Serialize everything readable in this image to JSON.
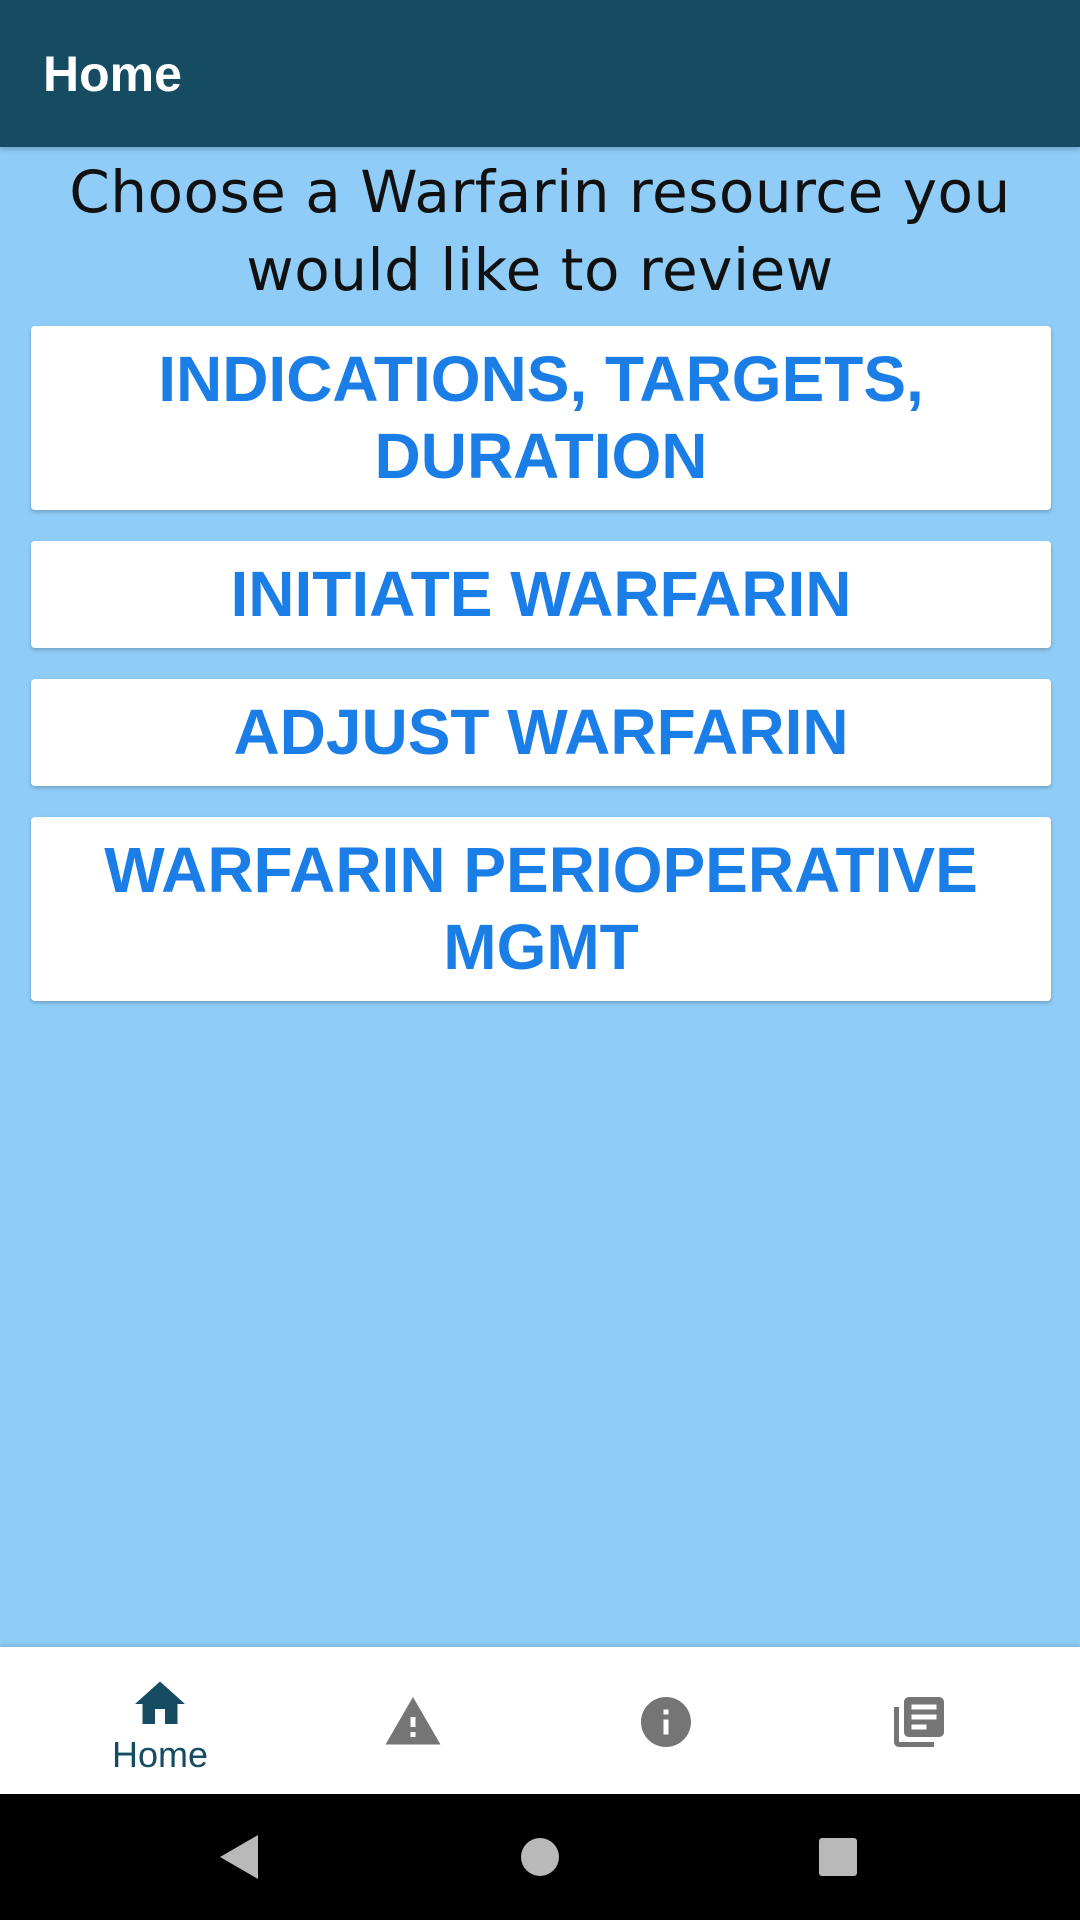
{
  "app_bar": {
    "title": "Home",
    "background_color": "#154c62"
  },
  "main": {
    "heading": "Choose a Warfarin resource you would like to review",
    "background_color": "#8fcdf8",
    "buttons": [
      {
        "label": "INDICATIONS, TARGETS, DURATION"
      },
      {
        "label": "INITIATE WARFARIN"
      },
      {
        "label": "ADJUST WARFARIN"
      },
      {
        "label": "WARFARIN PERIOPERATIVE MGMT"
      }
    ],
    "button_text_color": "#1a7ee6"
  },
  "bottom_nav": {
    "items": [
      {
        "icon": "home-icon",
        "label": "Home",
        "active": true
      },
      {
        "icon": "warning-icon",
        "label": "",
        "active": false
      },
      {
        "icon": "info-icon",
        "label": "",
        "active": false
      },
      {
        "icon": "library-books-icon",
        "label": "",
        "active": false
      }
    ],
    "active_color": "#154c62",
    "inactive_color": "#757575"
  },
  "system_nav": {
    "buttons": [
      {
        "icon": "back-triangle-icon"
      },
      {
        "icon": "home-circle-icon"
      },
      {
        "icon": "recents-square-icon"
      }
    ]
  }
}
